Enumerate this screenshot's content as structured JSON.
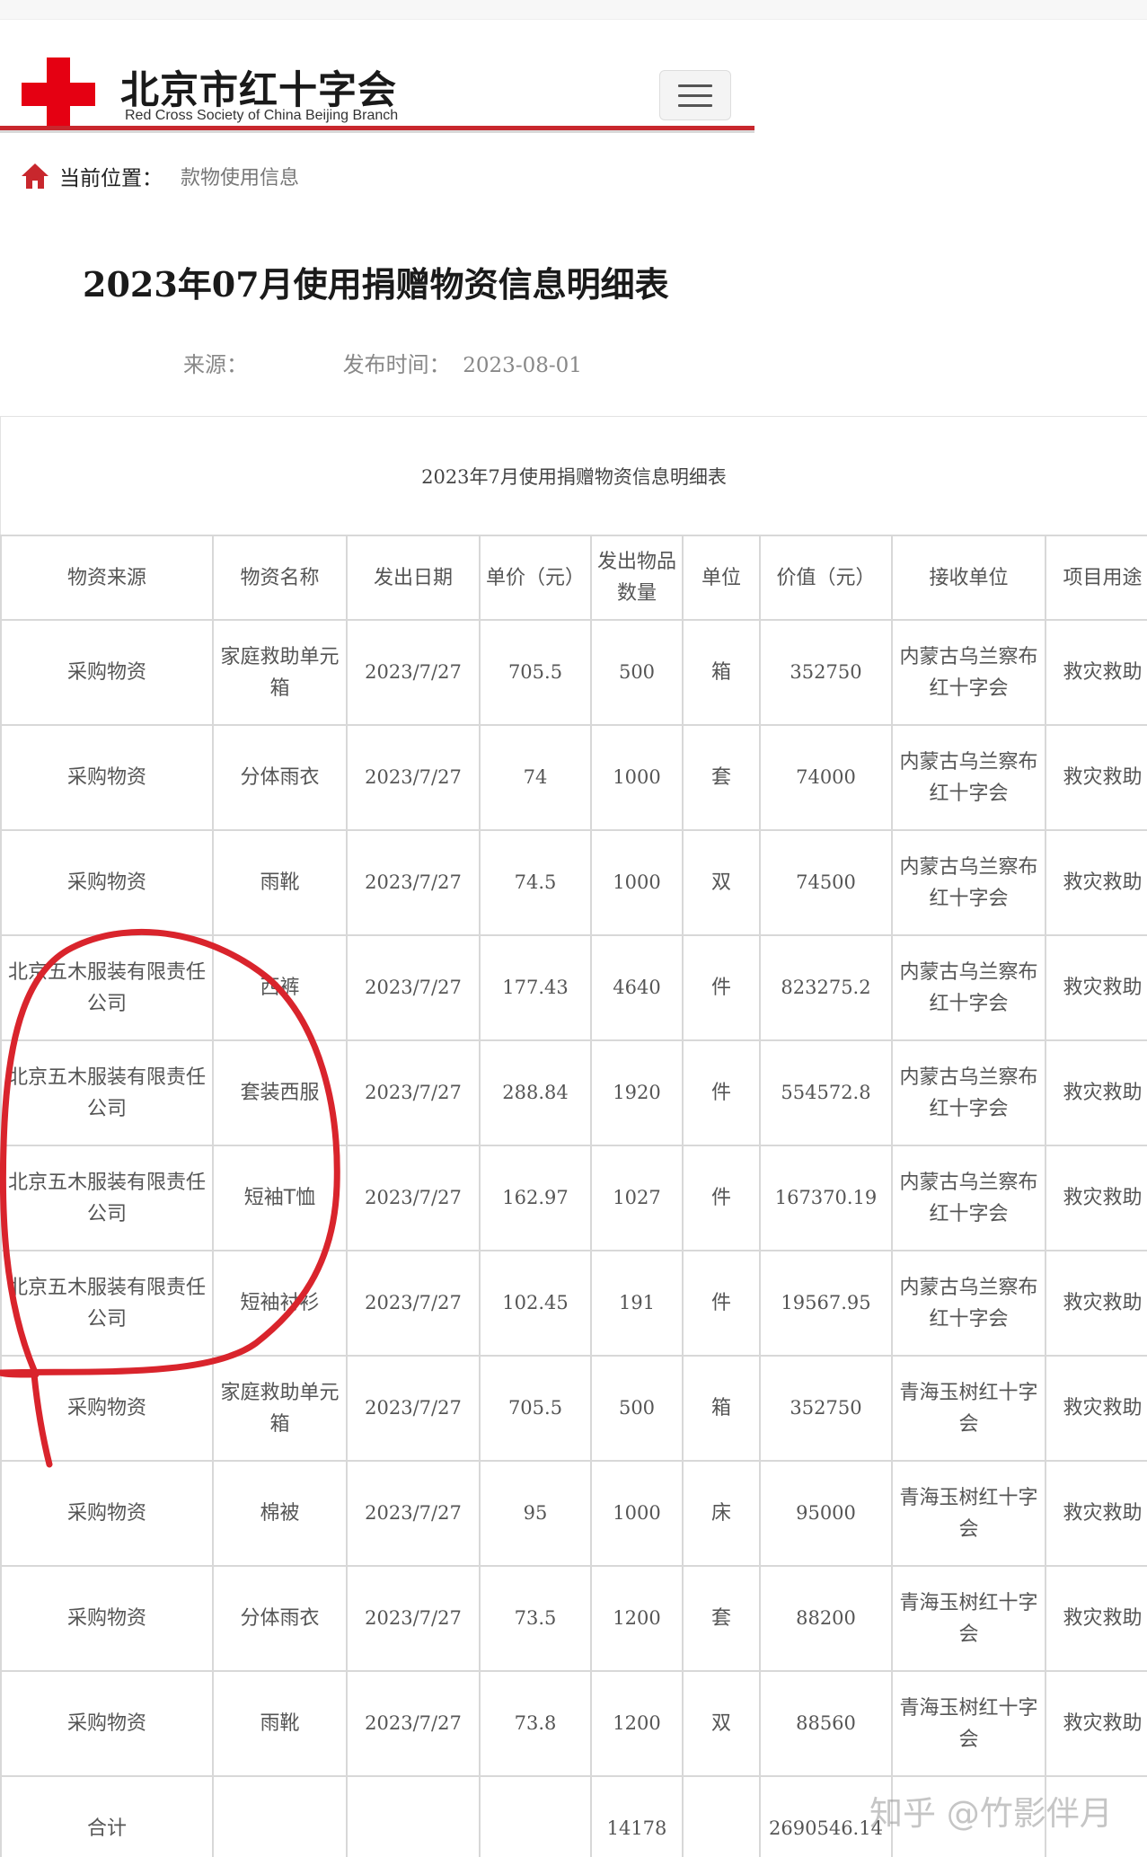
{
  "header": {
    "org_name_cn": "北京市红十字会",
    "org_name_en": "Red Cross Society of China Beijing Branch",
    "menu_icon": "hamburger-menu-icon",
    "accent_color": "#c8272d",
    "logo_color": "#e50012"
  },
  "breadcrumb": {
    "icon": "home-icon",
    "label": "当前位置：",
    "current": "款物使用信息"
  },
  "article": {
    "title": "2023年07月使用捐赠物资信息明细表",
    "source_label": "来源：",
    "publish_label": "发布时间：",
    "publish_date": "2023-08-01"
  },
  "table": {
    "caption": "2023年7月使用捐赠物资信息明细表",
    "headers": [
      "物资来源",
      "物资名称",
      "发出日期",
      "单价（元）",
      "发出物品数量",
      "单位",
      "价值（元）",
      "接收单位",
      "项目用途"
    ],
    "rows": [
      [
        "采购物资",
        "家庭救助单元箱",
        "2023/7/27",
        "705.5",
        "500",
        "箱",
        "352750",
        "内蒙古乌兰察布红十字会",
        "救灾救助"
      ],
      [
        "采购物资",
        "分体雨衣",
        "2023/7/27",
        "74",
        "1000",
        "套",
        "74000",
        "内蒙古乌兰察布红十字会",
        "救灾救助"
      ],
      [
        "采购物资",
        "雨靴",
        "2023/7/27",
        "74.5",
        "1000",
        "双",
        "74500",
        "内蒙古乌兰察布红十字会",
        "救灾救助"
      ],
      [
        "北京五木服装有限责任公司",
        "西裤",
        "2023/7/27",
        "177.43",
        "4640",
        "件",
        "823275.2",
        "内蒙古乌兰察布红十字会",
        "救灾救助"
      ],
      [
        "北京五木服装有限责任公司",
        "套装西服",
        "2023/7/27",
        "288.84",
        "1920",
        "件",
        "554572.8",
        "内蒙古乌兰察布红十字会",
        "救灾救助"
      ],
      [
        "北京五木服装有限责任公司",
        "短袖T恤",
        "2023/7/27",
        "162.97",
        "1027",
        "件",
        "167370.19",
        "内蒙古乌兰察布红十字会",
        "救灾救助"
      ],
      [
        "北京五木服装有限责任公司",
        "短袖衬衫",
        "2023/7/27",
        "102.45",
        "191",
        "件",
        "19567.95",
        "内蒙古乌兰察布红十字会",
        "救灾救助"
      ],
      [
        "采购物资",
        "家庭救助单元箱",
        "2023/7/27",
        "705.5",
        "500",
        "箱",
        "352750",
        "青海玉树红十字会",
        "救灾救助"
      ],
      [
        "采购物资",
        "棉被",
        "2023/7/27",
        "95",
        "1000",
        "床",
        "95000",
        "青海玉树红十字会",
        "救灾救助"
      ],
      [
        "采购物资",
        "分体雨衣",
        "2023/7/27",
        "73.5",
        "1200",
        "套",
        "88200",
        "青海玉树红十字会",
        "救灾救助"
      ],
      [
        "采购物资",
        "雨靴",
        "2023/7/27",
        "73.8",
        "1200",
        "双",
        "88560",
        "青海玉树红十字会",
        "救灾救助"
      ]
    ],
    "total": {
      "label": "合计",
      "quantity": "14178",
      "value": "2690546.14"
    }
  },
  "annotation": {
    "color": "#d9242c"
  },
  "watermark": "知乎 @竹影伴月"
}
